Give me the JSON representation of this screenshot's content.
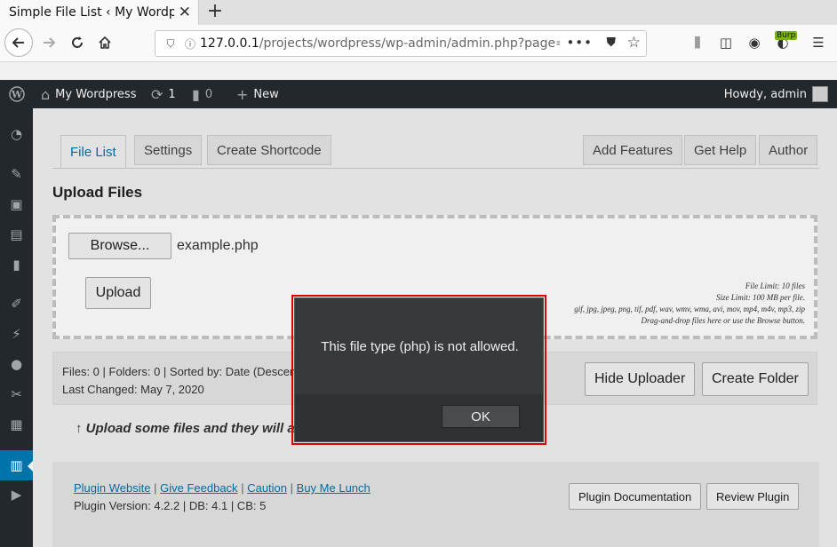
{
  "browser": {
    "tab_title": "Simple File List ‹ My Wordpre",
    "tab_close": "✕",
    "new_tab": "+",
    "url_host": "127.0.0.1",
    "url_path": "/projects/wordpress/wp-admin/admin.php?page=ee-s",
    "url_more": "•••",
    "burp_label": "Burp"
  },
  "adminbar": {
    "site_name": "My Wordpress",
    "updates_count": "1",
    "comments_count": "0",
    "new_label": "New",
    "howdy": "Howdy, admin"
  },
  "tabs": {
    "file_list": "File List",
    "settings": "Settings",
    "create_shortcode": "Create Shortcode",
    "add_features": "Add Features",
    "get_help": "Get Help",
    "author": "Author"
  },
  "upload": {
    "heading": "Upload Files",
    "browse_label": "Browse...",
    "selected_file": "example.php",
    "upload_label": "Upload",
    "limits": [
      "File Limit: 10 files",
      "Size Limit: 100 MB per file.",
      "gif, jpg, jpeg, png, tif, pdf, wav, wmv, wma, avi, mov, mp4, m4v, mp3, zip",
      "Drag-and-drop files here or use the Browse button."
    ]
  },
  "info": {
    "counts": "Files: 0 | Folders: 0 | Sorted by: Date (Descending)",
    "last_changed": "Last Changed: May 7, 2020",
    "hide_uploader": "Hide Uploader",
    "create_folder": "Create Folder"
  },
  "empty_message": "↑ Upload some files and they will appear here.",
  "footer": {
    "links": [
      "Plugin Website",
      "Give Feedback",
      "Caution",
      "Buy Me Lunch"
    ],
    "separator": "|",
    "version": "Plugin Version: 4.2.2 | DB: 4.1 | CB: 5",
    "plugin_doc": "Plugin Documentation",
    "review_plugin": "Review Plugin"
  },
  "modal": {
    "message": "This file type (php) is not allowed.",
    "ok_label": "OK"
  },
  "colors": {
    "wp_dark": "#23282d",
    "wp_blue": "#0073aa",
    "modal_bg": "#38393d",
    "highlight_red": "#e00000"
  }
}
